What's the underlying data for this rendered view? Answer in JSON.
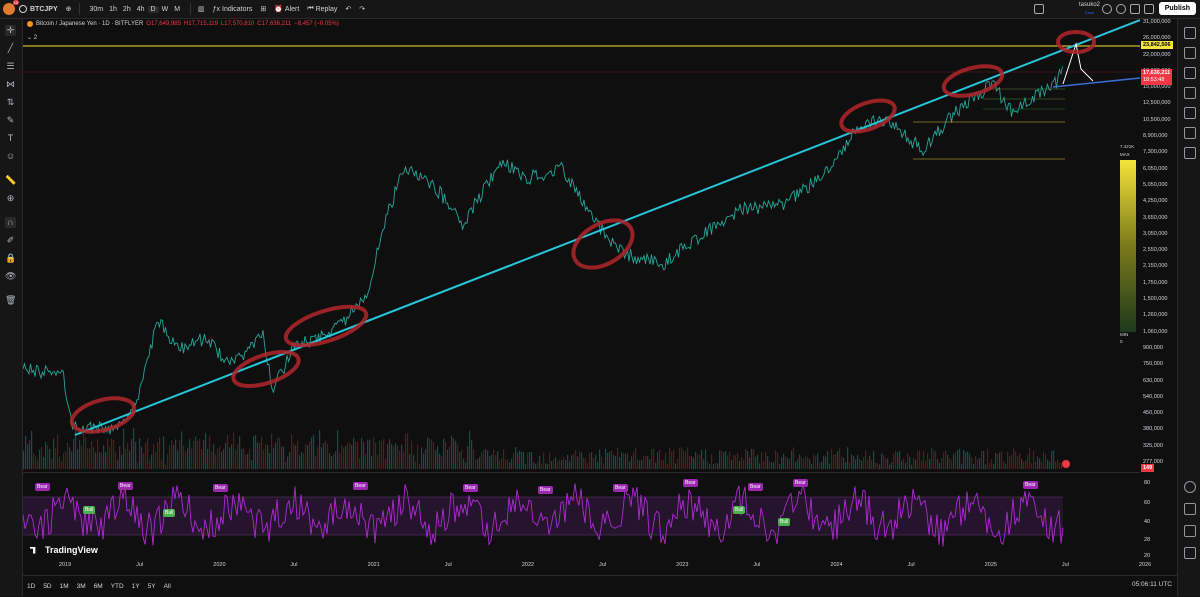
{
  "header": {
    "notifications": "10",
    "symbol": "BTCJPY",
    "timeframes": [
      "30m",
      "1h",
      "2h",
      "4h",
      "D",
      "W",
      "M"
    ],
    "active_timeframe": "D",
    "indicators_label": "Indicators",
    "alert_label": "Alert",
    "replay_label": "Replay",
    "username": "tasuko2",
    "save_label": "Save",
    "publish_label": "Publish"
  },
  "legend": {
    "title": "Bitcoin / Japanese Yen · 1D · BITFLYER",
    "open": "O17,649,985",
    "high": "H17,715,119",
    "low": "L17,570,810",
    "close": "C17,636,211",
    "change": "−8,457 (−0.05%)",
    "indicator_count": "2"
  },
  "price_axis": [
    "31,000,000",
    "26,000,000",
    "22,000,000",
    "18,000,000",
    "15,000,000",
    "12,500,000",
    "10,500,000",
    "8,900,000",
    "7,300,000",
    "6,050,000",
    "5,050,000",
    "4,250,000",
    "3,650,000",
    "3,050,000",
    "2,550,000",
    "2,150,000",
    "1,750,000",
    "1,500,000",
    "1,260,000",
    "1,060,000",
    "900,000",
    "750,000",
    "630,000",
    "540,000",
    "450,000",
    "380,000",
    "325,000",
    "277,000"
  ],
  "price_tags": {
    "target": "23,842,506",
    "current": "17,636,211",
    "countdown": "18:53:48",
    "volume": "149"
  },
  "heatmap": {
    "top": "7.421K",
    "max": "MAX",
    "min": "MIN",
    "zero": "0"
  },
  "rsi_axis": [
    "80",
    "60",
    "40",
    "28",
    "20"
  ],
  "rsi_tags": [
    {
      "t": "Bear",
      "type": "bear"
    },
    {
      "t": "Bull",
      "type": "bull"
    },
    {
      "t": "Bear",
      "type": "bear"
    },
    {
      "t": "Bull",
      "type": "bull"
    },
    {
      "t": "Bear",
      "type": "bear"
    },
    {
      "t": "Bear",
      "type": "bear"
    },
    {
      "t": "Bear",
      "type": "bear"
    },
    {
      "t": "Bear",
      "type": "bear"
    },
    {
      "t": "Bear",
      "type": "bear"
    },
    {
      "t": "Bull",
      "type": "bull"
    },
    {
      "t": "Bear",
      "type": "bear"
    },
    {
      "t": "Bear",
      "type": "bear"
    },
    {
      "t": "Bear",
      "type": "bear"
    },
    {
      "t": "Bull",
      "type": "bull"
    },
    {
      "t": "Bear",
      "type": "bear"
    }
  ],
  "time_axis": [
    "2019",
    "Jul",
    "2020",
    "Jul",
    "2021",
    "Jul",
    "2022",
    "Jul",
    "2023",
    "Jul",
    "2024",
    "Jul",
    "2025",
    "Jul",
    "2026"
  ],
  "ranges": [
    "1D",
    "5D",
    "1M",
    "3M",
    "6M",
    "YTD",
    "1Y",
    "5Y",
    "All"
  ],
  "clock": "05:06:11 UTC",
  "branding": "TradingView",
  "colors": {
    "trendline": "#26c6da",
    "target_line": "#f5e43a",
    "support_line": "#3b6fd6",
    "circles": "#b3262c",
    "rsi": "#b02ad6"
  }
}
